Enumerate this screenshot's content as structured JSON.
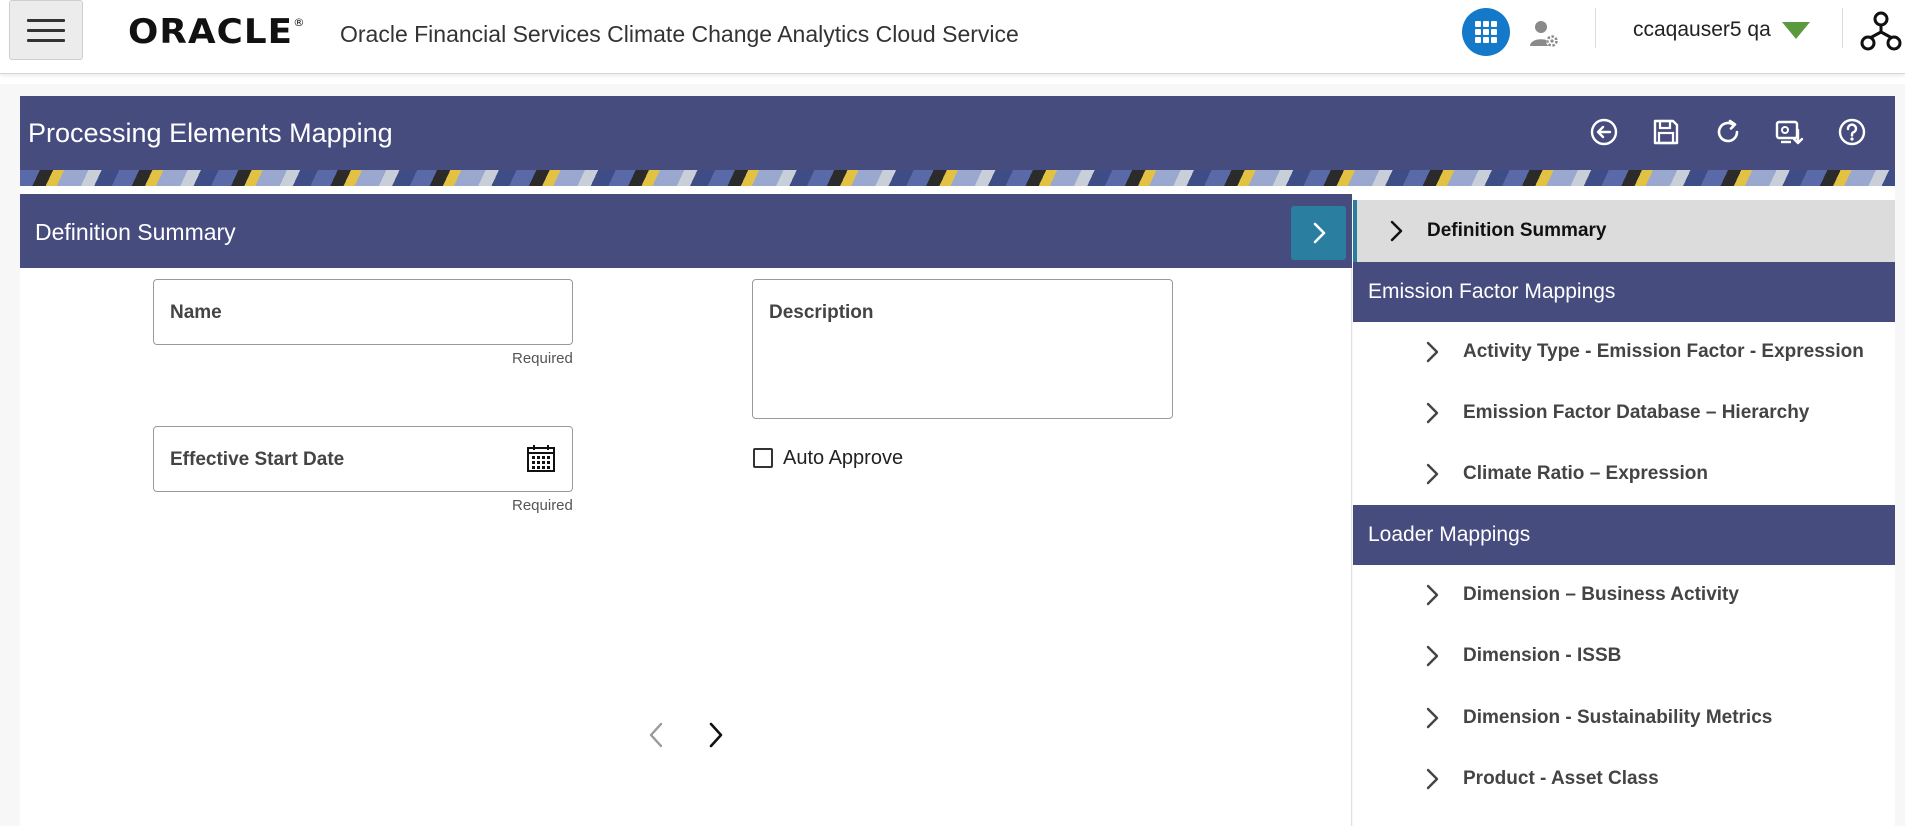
{
  "header": {
    "brand": "ORACLE",
    "app_title": "Oracle Financial Services Climate Change Analytics Cloud Service",
    "user_name": "ccaqauser5 qa"
  },
  "page": {
    "title": "Processing Elements Mapping"
  },
  "definition": {
    "section_title": "Definition Summary",
    "name_label": "Name",
    "name_required": "Required",
    "description_label": "Description",
    "start_date_label": "Effective Start Date",
    "start_date_required": "Required",
    "auto_approve_label": "Auto Approve",
    "auto_approve_checked": false
  },
  "nav": {
    "selected": "Definition Summary",
    "groups": [
      {
        "title": "Emission Factor Mappings",
        "items": [
          "Activity Type - Emission Factor - Expression",
          "Emission Factor Database – Hierarchy",
          "Climate Ratio – Expression"
        ]
      },
      {
        "title": "Loader Mappings",
        "items": [
          "Dimension – Business Activity",
          "Dimension - ISSB",
          "Dimension - Sustainability Metrics",
          "Product - Asset Class"
        ]
      }
    ]
  },
  "colors": {
    "header_bar": "#474c7f",
    "accent_button": "#2a7fa0",
    "apps_button": "#1479c9",
    "user_caret": "#5b9a3c"
  }
}
